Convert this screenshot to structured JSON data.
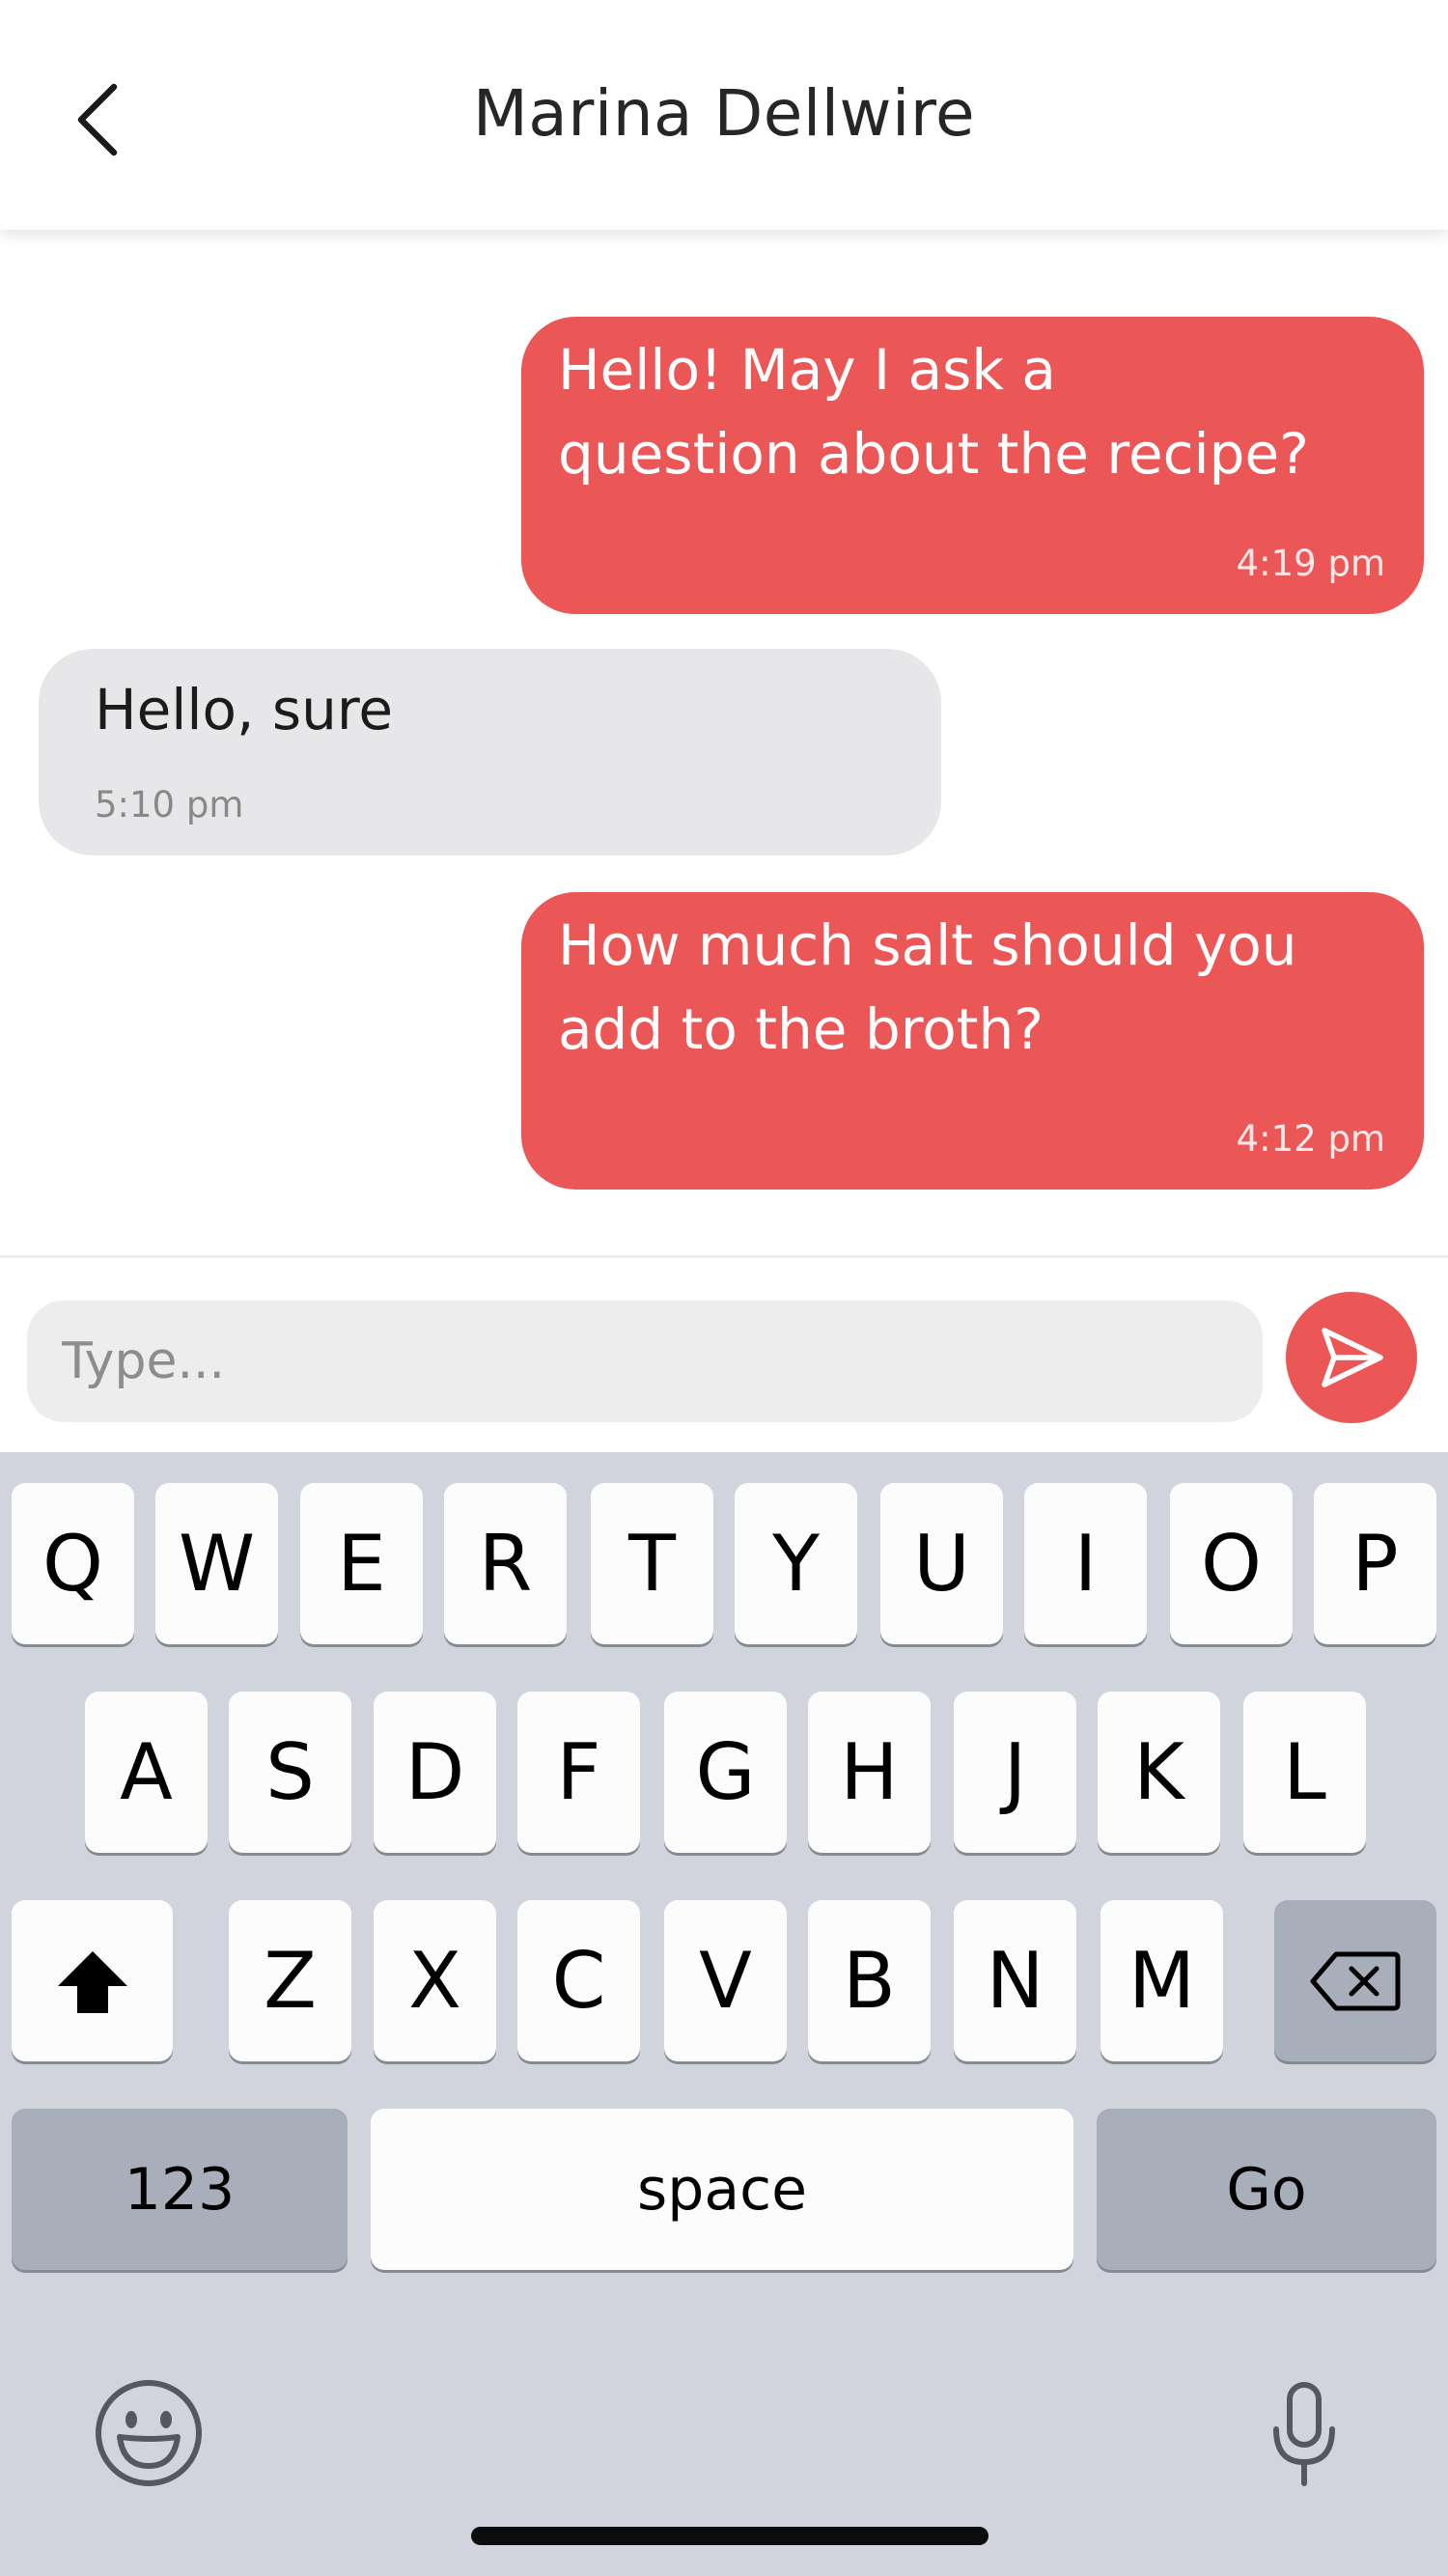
{
  "header": {
    "title": "Marina Dellwire",
    "back_icon": "chevron-left-icon"
  },
  "messages": [
    {
      "direction": "outgoing",
      "lines": [
        "Hello! May I ask a",
        "question about the recipe?"
      ],
      "time": "4:19 pm"
    },
    {
      "direction": "incoming",
      "lines": [
        "Hello, sure"
      ],
      "time": "5:10 pm"
    },
    {
      "direction": "outgoing",
      "lines": [
        "How much salt should you",
        "add to the broth?"
      ],
      "time": "4:12 pm"
    }
  ],
  "composer": {
    "placeholder": "Type...",
    "value": "",
    "send_icon": "send-icon"
  },
  "keyboard": {
    "row1": [
      "Q",
      "W",
      "E",
      "R",
      "T",
      "Y",
      "U",
      "I",
      "O",
      "P"
    ],
    "row2": [
      "A",
      "S",
      "D",
      "F",
      "G",
      "H",
      "J",
      "K",
      "L"
    ],
    "row3": [
      "Z",
      "X",
      "C",
      "V",
      "B",
      "N",
      "M"
    ],
    "numbers_label": "123",
    "space_label": "space",
    "go_label": "Go",
    "shift_icon": "shift-icon",
    "backspace_icon": "backspace-icon",
    "emoji_icon": "emoji-icon",
    "mic_icon": "microphone-icon"
  },
  "colors": {
    "accent": "#eb5757",
    "incoming_bubble": "#e7e7ea",
    "keyboard_bg": "#d1d4dc"
  }
}
